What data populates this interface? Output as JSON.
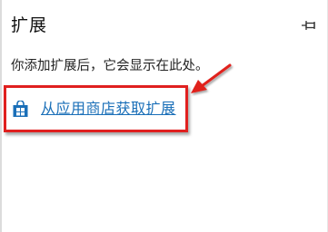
{
  "panel": {
    "title": "扩展",
    "pin_icon": "pin-icon",
    "empty_message": "你添加扩展后，它会显示在此处。",
    "store_link": {
      "label": "从应用商店获取扩展",
      "icon": "store-bag-icon"
    }
  },
  "colors": {
    "link": "#1a6fb8",
    "annotation": "#e0201f",
    "title": "#111111"
  }
}
